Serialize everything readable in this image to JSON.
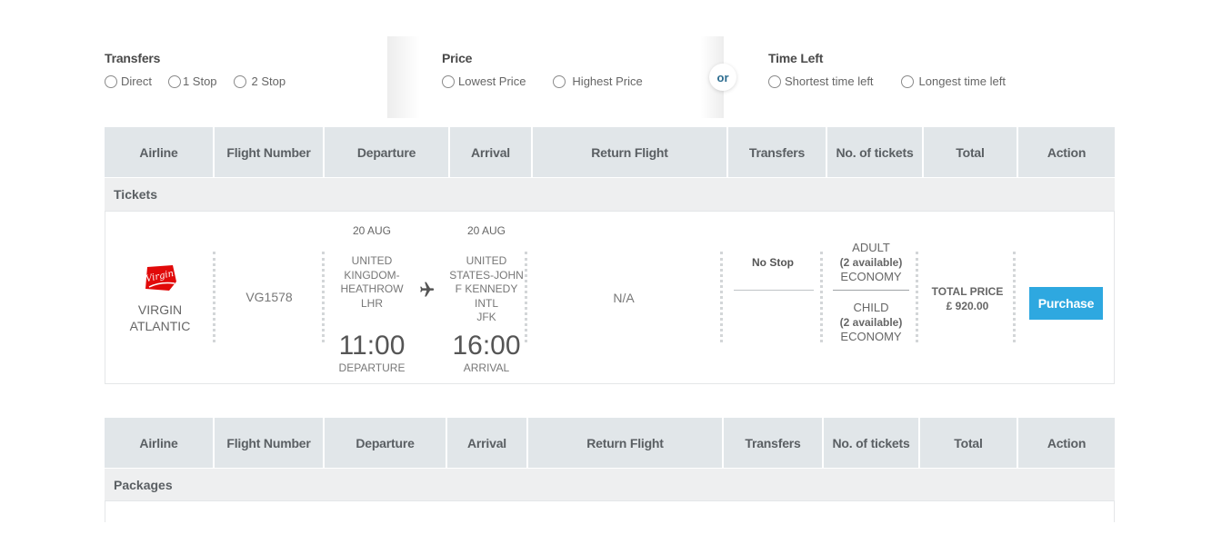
{
  "filters": {
    "transfers": {
      "title": "Transfers",
      "options": [
        "Direct",
        "1 Stop",
        "2 Stop"
      ]
    },
    "price": {
      "title": "Price",
      "options": [
        "Lowest Price",
        "Highest Price"
      ]
    },
    "or_label": "or",
    "time_left": {
      "title": "Time Left",
      "options": [
        "Shortest time left",
        "Longest time left"
      ]
    }
  },
  "table_headers": [
    "Airline",
    "Flight Number",
    "Departure",
    "Arrival",
    "Return Flight",
    "Transfers",
    "No. of tickets",
    "Total",
    "Action"
  ],
  "tickets_section": {
    "label": "Tickets"
  },
  "packages_section": {
    "label": "Packages"
  },
  "flight": {
    "airline": {
      "logo_text": "Virgin",
      "name_line1": "VIRGIN",
      "name_line2": "ATLANTIC"
    },
    "flight_number": "VG1578",
    "departure": {
      "date": "20 AUG",
      "place_lines": [
        "UNITED",
        "KINGDOM-",
        "HEATHROW",
        "LHR"
      ],
      "time": "11:00",
      "label": "DEPARTURE"
    },
    "arrival": {
      "date": "20 AUG",
      "place_lines": [
        "UNITED",
        "STATES-JOHN",
        "F KENNEDY",
        "INTL",
        "JFK"
      ],
      "time": "16:00",
      "label": "ARRIVAL"
    },
    "return_flight": "N/A",
    "transfers": "No Stop",
    "tickets": {
      "adult": {
        "type": "ADULT",
        "available": "(2 available)",
        "class": "ECONOMY"
      },
      "child": {
        "type": "CHILD",
        "available": "(2 available)",
        "class": "ECONOMY"
      }
    },
    "total": {
      "label": "TOTAL PRICE",
      "amount": "£ 920.00"
    },
    "action_label": "Purchase"
  },
  "icons": {
    "plane": "airplane-icon",
    "logo": "virgin-logo"
  },
  "colors": {
    "header_bg": "#e1e6e9",
    "section_bg": "#eeeff0",
    "purchase_button": "#2ea8e0",
    "logo_red": "#e10a0a",
    "or_text": "#2b6c8f"
  }
}
